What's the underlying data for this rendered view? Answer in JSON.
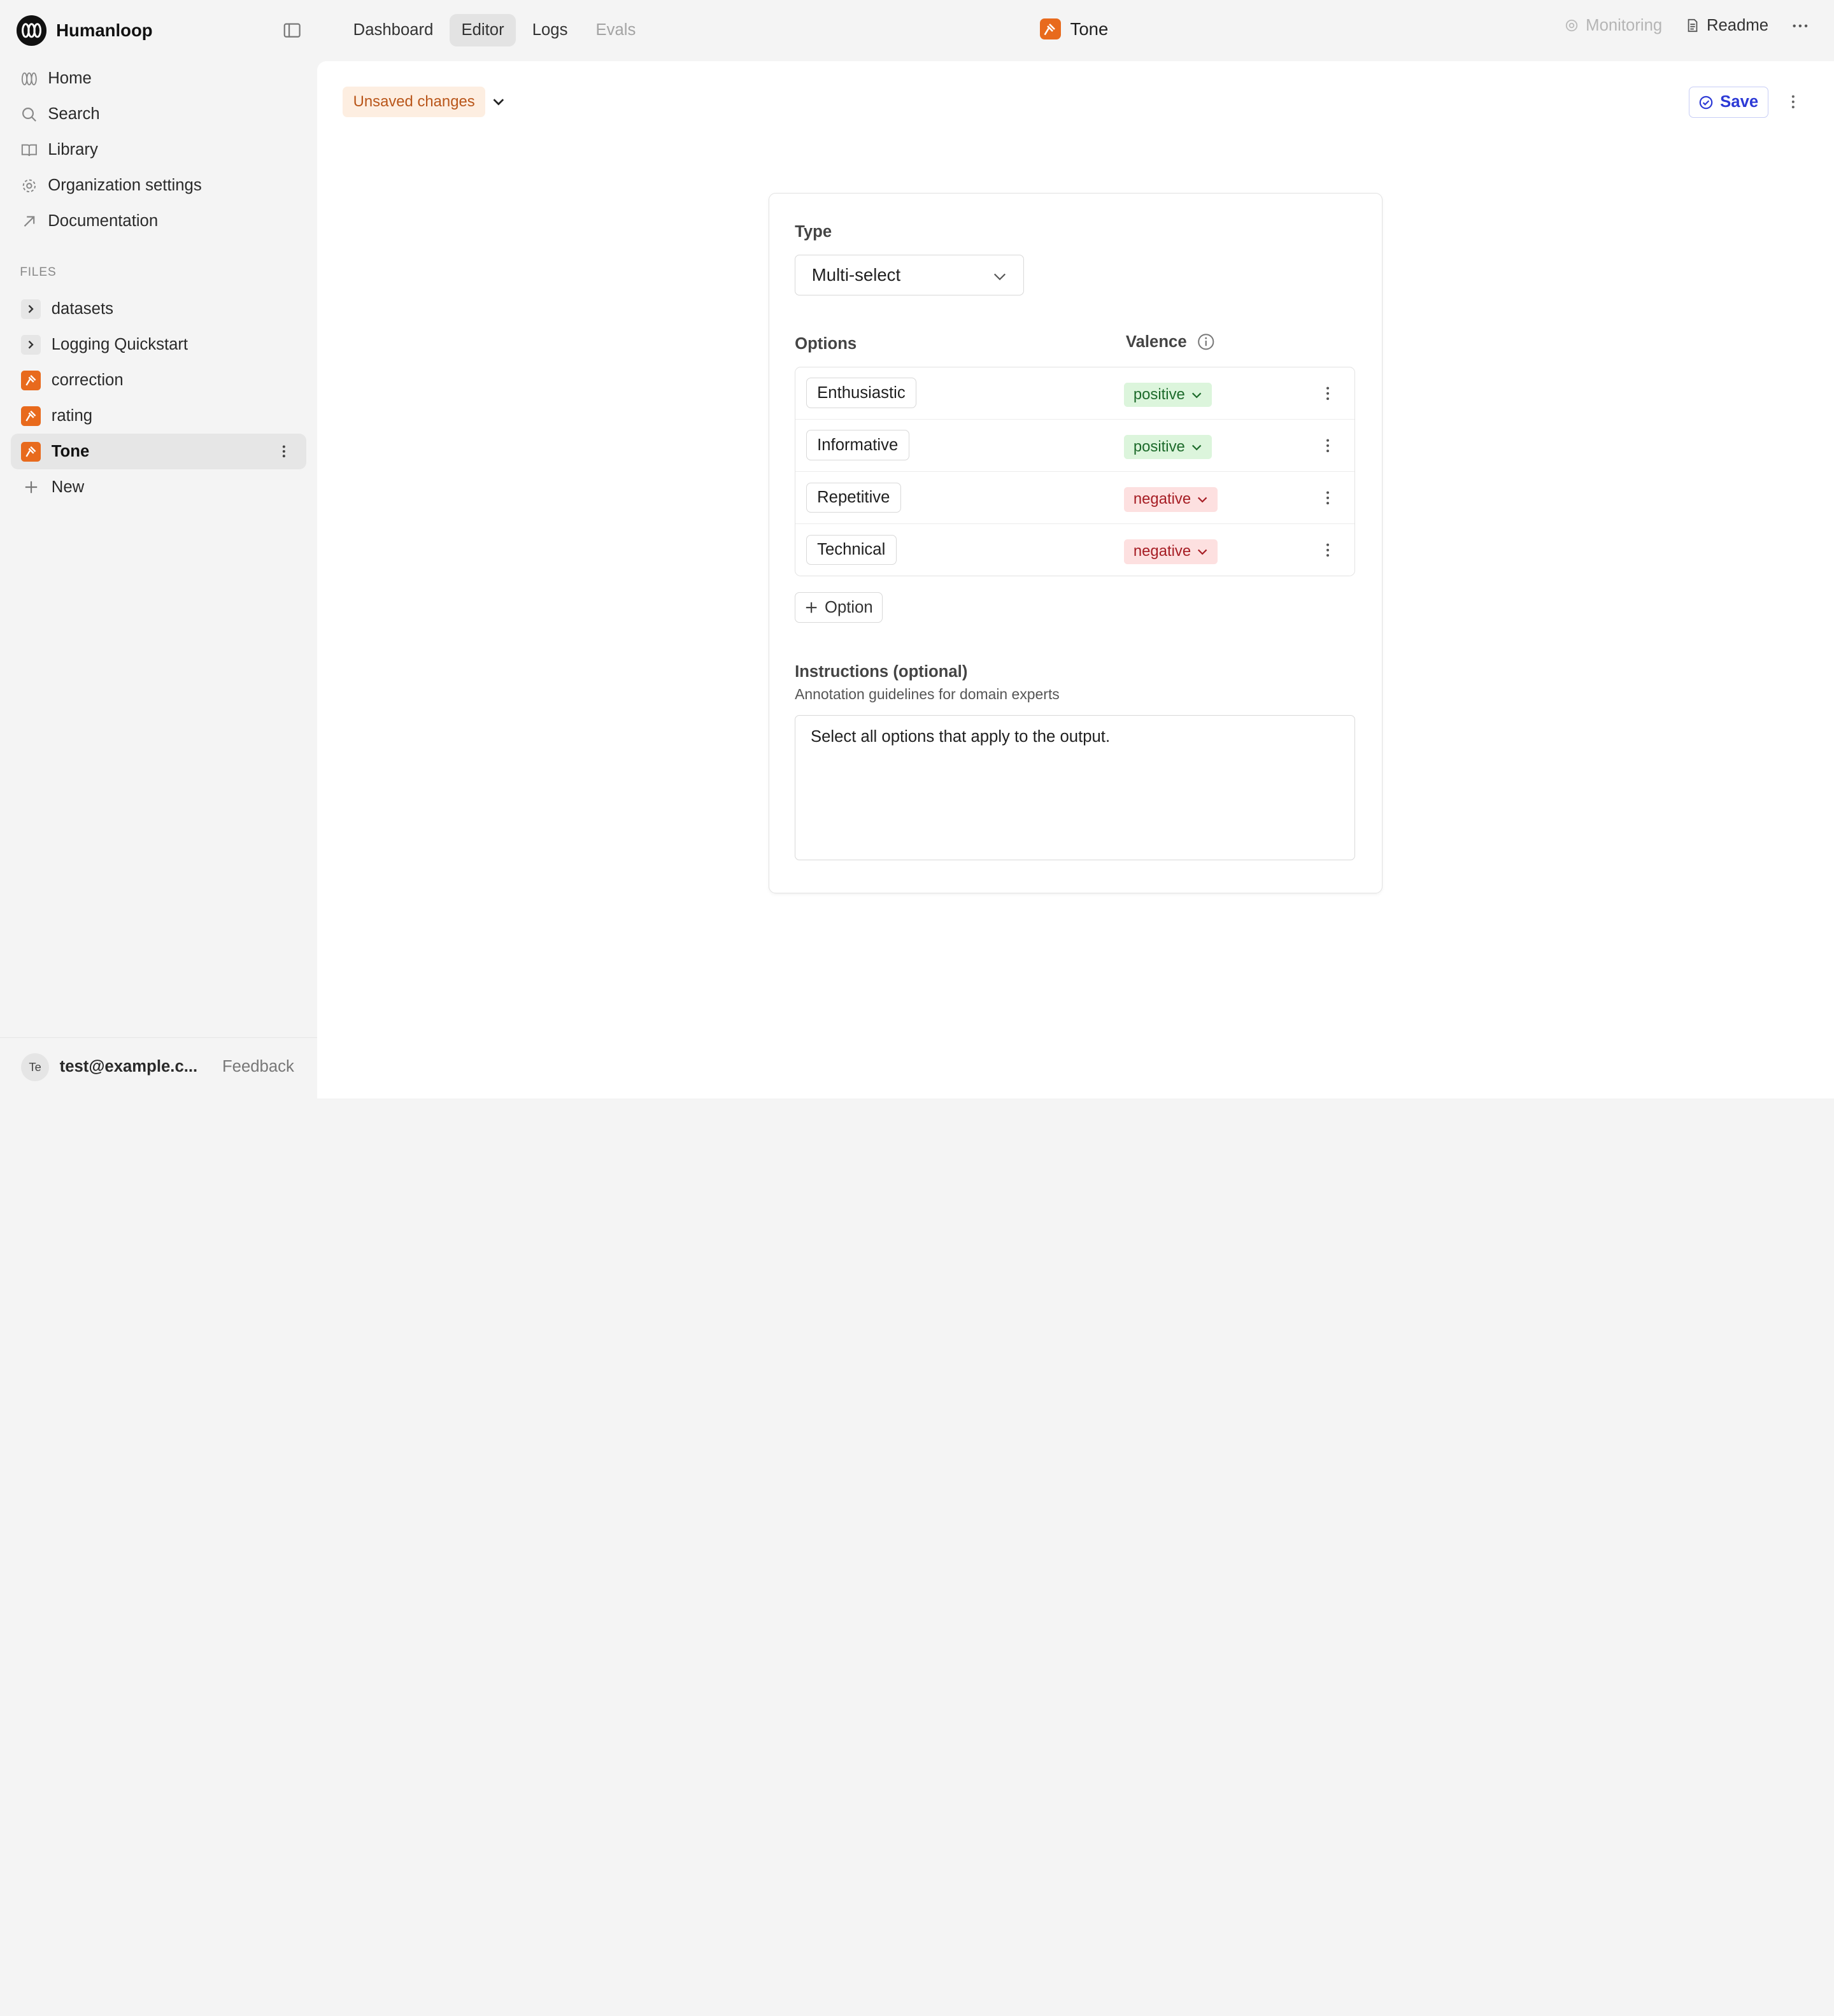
{
  "app": {
    "name": "Humanloop"
  },
  "sidebar": {
    "nav": [
      {
        "label": "Home",
        "icon": "home-loops-icon"
      },
      {
        "label": "Search",
        "icon": "search-icon"
      },
      {
        "label": "Library",
        "icon": "book-icon"
      },
      {
        "label": "Organization settings",
        "icon": "gear-icon"
      },
      {
        "label": "Documentation",
        "icon": "arrow-up-right-icon"
      }
    ],
    "files_label": "FILES",
    "files": [
      {
        "label": "datasets",
        "kind": "folder"
      },
      {
        "label": "Logging Quickstart",
        "kind": "folder"
      },
      {
        "label": "correction",
        "kind": "evaluator"
      },
      {
        "label": "rating",
        "kind": "evaluator"
      },
      {
        "label": "Tone",
        "kind": "evaluator",
        "active": true
      }
    ],
    "new_label": "New",
    "user": {
      "initials": "Te",
      "email": "test@example.c..."
    },
    "feedback_label": "Feedback"
  },
  "topbar": {
    "tabs": [
      {
        "label": "Dashboard",
        "state": "normal"
      },
      {
        "label": "Editor",
        "state": "active"
      },
      {
        "label": "Logs",
        "state": "normal"
      },
      {
        "label": "Evals",
        "state": "disabled"
      }
    ],
    "title": "Tone",
    "monitoring_label": "Monitoring",
    "readme_label": "Readme"
  },
  "editor": {
    "status": "Unsaved changes",
    "save_label": "Save",
    "type_label": "Type",
    "type_value": "Multi-select",
    "options_label": "Options",
    "valence_label": "Valence",
    "options": [
      {
        "name": "Enthusiastic",
        "valence": "positive"
      },
      {
        "name": "Informative",
        "valence": "positive"
      },
      {
        "name": "Repetitive",
        "valence": "negative"
      },
      {
        "name": "Technical",
        "valence": "negative"
      }
    ],
    "add_option_label": "Option",
    "instructions_label": "Instructions (optional)",
    "instructions_sub": "Annotation guidelines for domain experts",
    "instructions_value": "Select all options that apply to the output."
  },
  "colors": {
    "accent": "#2d3ad6",
    "evaluator_icon": "#e86a1d",
    "positive_bg": "#dcf5dc",
    "negative_bg": "#fde0e0",
    "unsaved_bg": "#fdeee1"
  }
}
